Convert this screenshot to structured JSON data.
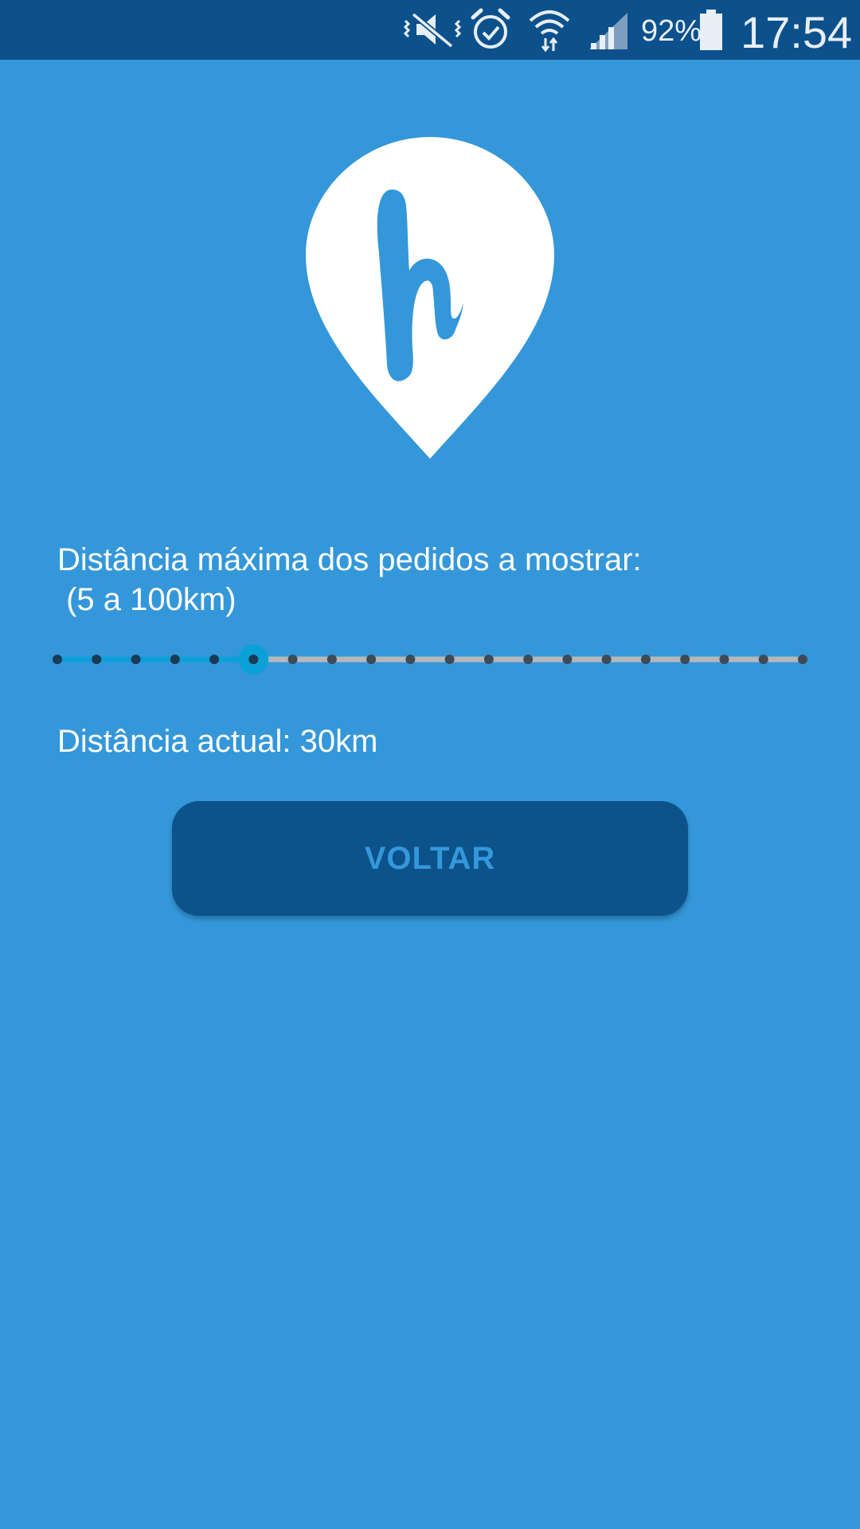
{
  "status_bar": {
    "battery_percent": "92%",
    "time": "17:54",
    "icons": [
      "mute-vibrate-icon",
      "alarm-icon",
      "wifi-icon",
      "signal-icon",
      "battery-icon"
    ]
  },
  "logo": {
    "letter": "h",
    "icon": "map-pin-logo"
  },
  "settings": {
    "max_distance_label": "Distância máxima dos pedidos a mostrar:",
    "range_label": " (5 a 100km)",
    "current_distance_label": "Distância actual: 30km"
  },
  "slider": {
    "min": 5,
    "max": 100,
    "step": 5,
    "value": 30
  },
  "button": {
    "label": "VOLTAR"
  },
  "colors": {
    "background": "#3497d9",
    "status_bar": "#0c518b",
    "button": "#0c528b",
    "button_text": "#3498db",
    "slider_active": "#0ba1d8",
    "slider_inactive": "#b5b8bb"
  }
}
